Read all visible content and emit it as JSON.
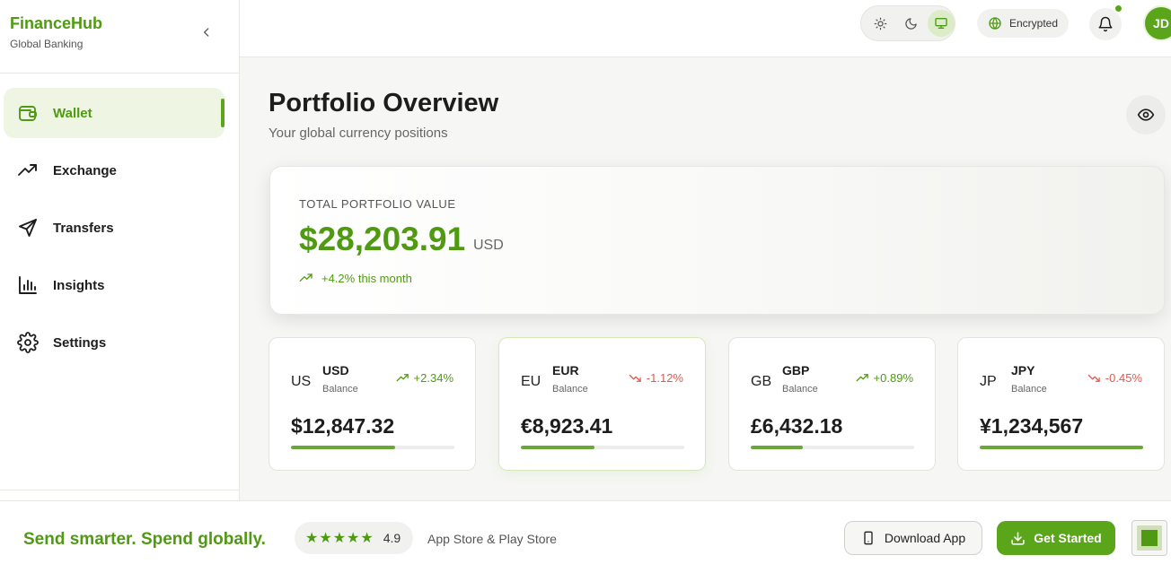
{
  "brand": {
    "name": "FinanceHub",
    "subtitle": "Global Banking"
  },
  "sidebar": {
    "items": [
      {
        "label": "Wallet",
        "icon": "wallet-icon",
        "active": true
      },
      {
        "label": "Exchange",
        "icon": "trending-up-icon",
        "active": false
      },
      {
        "label": "Transfers",
        "icon": "send-icon",
        "active": false
      },
      {
        "label": "Insights",
        "icon": "bar-chart-icon",
        "active": false
      },
      {
        "label": "Settings",
        "icon": "gear-icon",
        "active": false
      }
    ]
  },
  "topbar": {
    "theme_options": [
      "sun-icon",
      "moon-icon",
      "monitor-icon"
    ],
    "theme_active": "monitor-icon",
    "encrypted_label": "Encrypted",
    "avatar_initials": "JD"
  },
  "header": {
    "title": "Portfolio Overview",
    "subtitle": "Your global currency positions"
  },
  "portfolio": {
    "label": "TOTAL PORTFOLIO VALUE",
    "amount": "$28,203.91",
    "unit": "USD",
    "change": "+4.2% this month"
  },
  "currencies": [
    {
      "flag": "US",
      "code": "USD",
      "sub": "Balance",
      "change": "+2.34%",
      "direction": "up",
      "amount": "$12,847.32",
      "progress": 0.64
    },
    {
      "flag": "EU",
      "code": "EUR",
      "sub": "Balance",
      "change": "-1.12%",
      "direction": "down",
      "amount": "€8,923.41",
      "progress": 0.45
    },
    {
      "flag": "GB",
      "code": "GBP",
      "sub": "Balance",
      "change": "+0.89%",
      "direction": "up",
      "amount": "£6,432.18",
      "progress": 0.32
    },
    {
      "flag": "JP",
      "code": "JPY",
      "sub": "Balance",
      "change": "-0.45%",
      "direction": "down",
      "amount": "¥1,234,567",
      "progress": 1.0
    }
  ],
  "promo": {
    "headline": "Send smarter. Spend globally.",
    "stars": "★★★★★",
    "rating": "4.9",
    "stores": "App Store & Play Store",
    "download_label": "Download App",
    "started_label": "Get Started"
  },
  "colors": {
    "accent": "#5aa51a",
    "accent_text": "#4f9a12",
    "negative": "#e05a50"
  }
}
